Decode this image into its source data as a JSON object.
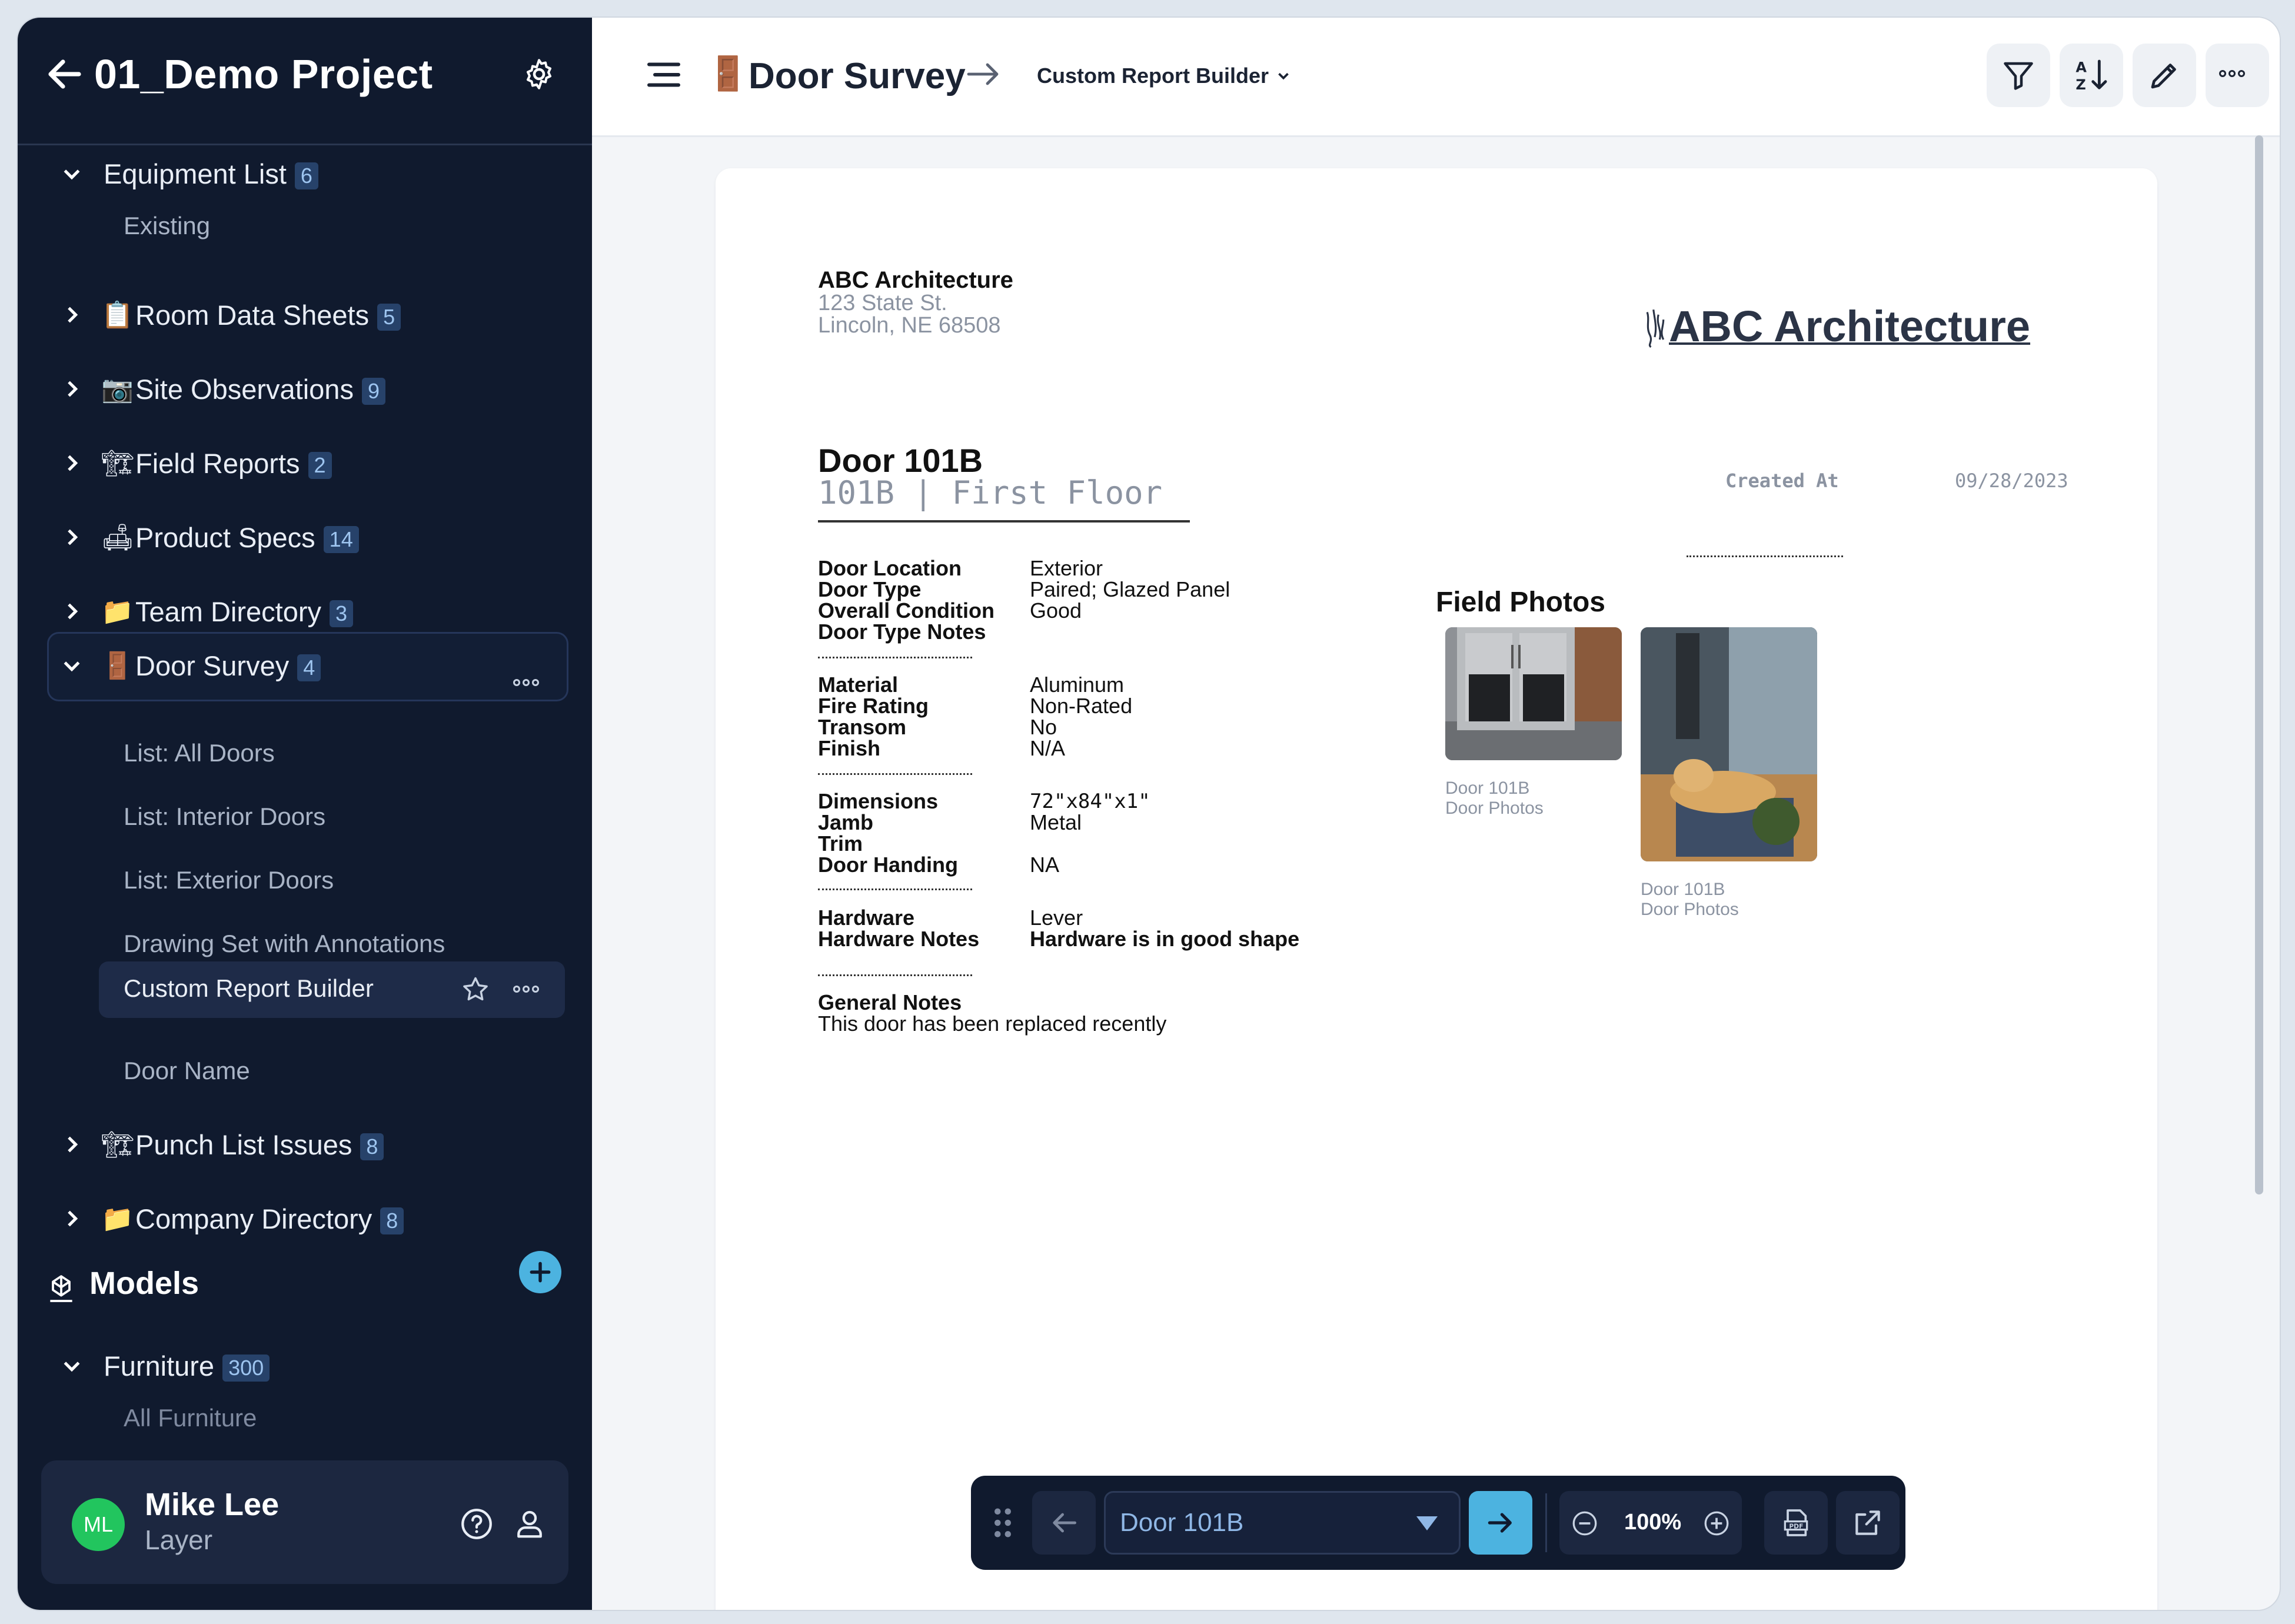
{
  "project": {
    "title": "01_Demo Project"
  },
  "sidebar": {
    "items": [
      {
        "label": "Equipment List",
        "count": "6",
        "emoji": ""
      },
      {
        "label": "Room Data Sheets",
        "count": "5",
        "emoji": "📋"
      },
      {
        "label": "Site Observations",
        "count": "9",
        "emoji": "📷"
      },
      {
        "label": "Field Reports",
        "count": "2",
        "emoji": "🏗"
      },
      {
        "label": "Product Specs",
        "count": "14",
        "emoji": "🛋"
      },
      {
        "label": "Team Directory",
        "count": "3",
        "emoji": "📁"
      },
      {
        "label": "Door Survey",
        "count": "4",
        "emoji": "🚪"
      },
      {
        "label": "Punch List Issues",
        "count": "8",
        "emoji": "🏗"
      },
      {
        "label": "Company Directory",
        "count": "8",
        "emoji": "📁"
      }
    ],
    "equipment_sub": [
      "Existing"
    ],
    "door_survey_sub": [
      "List: All Doors",
      "List: Interior Doors",
      "List: Exterior Doors",
      "Drawing Set with Annotations",
      "Custom Report Builder",
      "Door Name"
    ],
    "models": {
      "heading": "Models",
      "furniture": {
        "label": "Furniture",
        "count": "300"
      },
      "furniture_sub": "All Furniture"
    },
    "user": {
      "initials": "ML",
      "name": "Mike Lee",
      "role": "Layer"
    }
  },
  "topbar": {
    "door_emoji": "🚪",
    "title": "Door Survey",
    "subtitle": "Custom Report Builder"
  },
  "report": {
    "company": "ABC Architecture",
    "address1": "123 State St.",
    "address2": "Lincoln, NE 68508",
    "logo_text": "ABC Architecture",
    "door_name": "Door 101B",
    "door_subtitle": "101B | First Floor",
    "created_label": "Created At",
    "created_value": "09/28/2023",
    "groups": [
      [
        {
          "k": "Door Location",
          "v": "Exterior"
        },
        {
          "k": "Door Type",
          "v": "Paired; Glazed Panel"
        },
        {
          "k": "Overall Condition",
          "v": "Good"
        },
        {
          "k": "Door Type Notes",
          "v": ""
        }
      ],
      [
        {
          "k": "Material",
          "v": "Aluminum"
        },
        {
          "k": "Fire Rating",
          "v": "Non-Rated"
        },
        {
          "k": "Transom",
          "v": "No"
        },
        {
          "k": "Finish",
          "v": "N/A"
        }
      ],
      [
        {
          "k": "Dimensions",
          "v": "72\"x84\"x1\""
        },
        {
          "k": "Jamb",
          "v": "Metal"
        },
        {
          "k": "Trim",
          "v": ""
        },
        {
          "k": "Door Handing",
          "v": "NA"
        }
      ],
      [
        {
          "k": "Hardware",
          "v": "Lever"
        },
        {
          "k": "Hardware Notes",
          "v": "Hardware is in good shape"
        }
      ]
    ],
    "general_label": "General Notes",
    "general_value": "This door has been replaced recently",
    "photos_heading": "Field Photos",
    "photo_caption1": "Door 101B",
    "photo_caption2": "Door Photos"
  },
  "dock": {
    "record": "Door 101B",
    "zoom": "100%"
  }
}
